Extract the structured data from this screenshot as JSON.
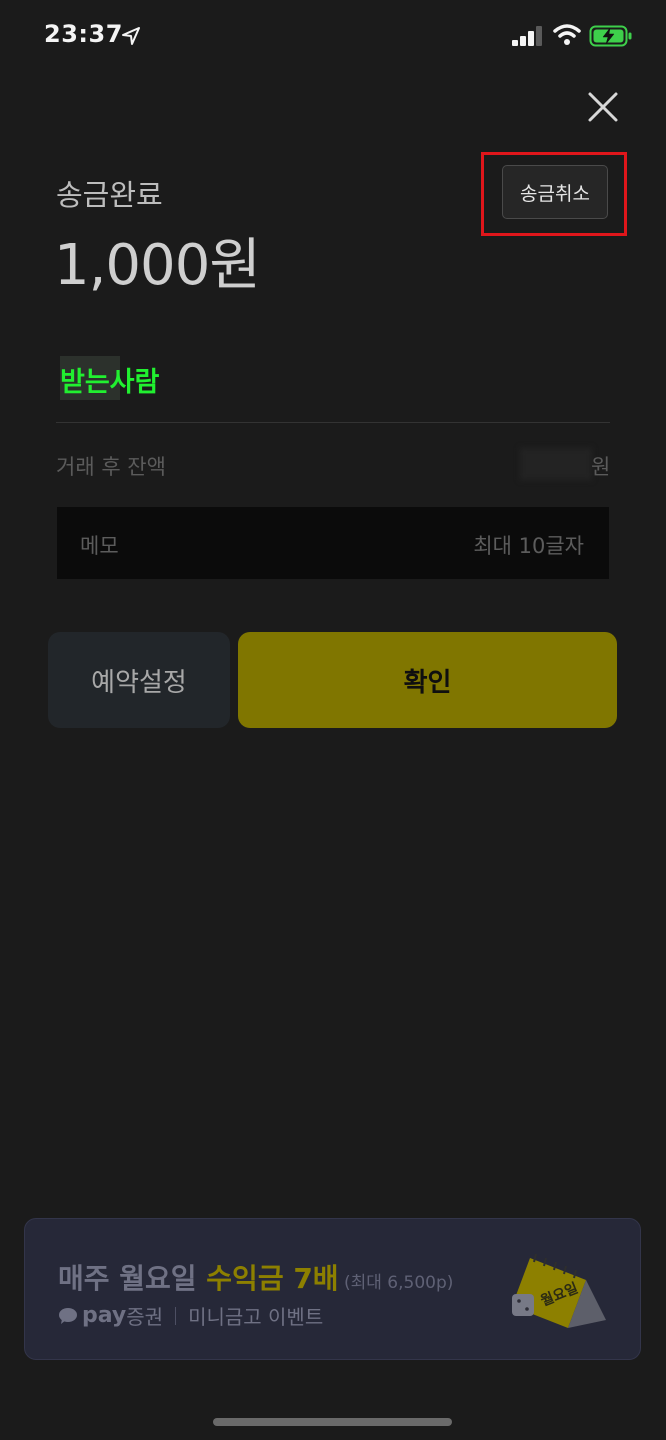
{
  "status_bar": {
    "time": "23:37"
  },
  "header": {
    "title": "송금완료",
    "amount": "1,000원",
    "cancel_label": "송금취소"
  },
  "recipient": {
    "label": "받는사람"
  },
  "balance": {
    "label": "거래 후 잔액",
    "unit": "원"
  },
  "memo": {
    "label": "메모",
    "placeholder": "최대 10글자"
  },
  "buttons": {
    "reserve": "예약설정",
    "confirm": "확인"
  },
  "banner": {
    "line1_a": "매주 월요일 ",
    "line1_b": "수익금 7배",
    "line1_c": " (최대 6,500p)",
    "brand": "pay",
    "brand_suffix": " 증권",
    "line2": "미니금고 이벤트",
    "calendar_text": "월요일"
  },
  "colors": {
    "background": "#1b1b1b",
    "confirm_button": "#807600",
    "reserve_button": "#22262a",
    "highlight": "#e0161b",
    "recipient_green": "#21f030"
  }
}
